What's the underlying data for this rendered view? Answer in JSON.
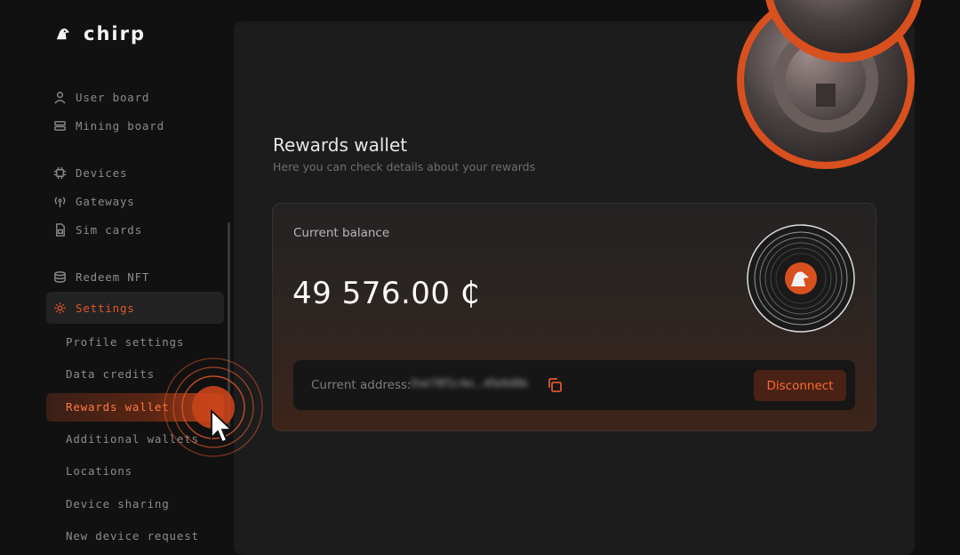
{
  "brand": {
    "name": "chirp",
    "logo_icon": "chirp-bird-icon"
  },
  "sidebar": {
    "items": [
      {
        "label": "User board",
        "icon": "user-icon"
      },
      {
        "label": "Mining board",
        "icon": "mining-icon"
      },
      {
        "label": "Devices",
        "icon": "chip-icon"
      },
      {
        "label": "Gateways",
        "icon": "antenna-icon"
      },
      {
        "label": "Sim cards",
        "icon": "sim-icon"
      },
      {
        "label": "Redeem NFT",
        "icon": "database-icon"
      },
      {
        "label": "Settings",
        "icon": "gear-icon",
        "active": true
      }
    ],
    "settings_sub": [
      "Profile settings",
      "Data credits",
      "Rewards wallet",
      "Additional wallets",
      "Locations",
      "Device sharing",
      "New device request"
    ],
    "active_sub": "Rewards wallet"
  },
  "page": {
    "title": "Rewards wallet",
    "subtitle": "Here you can check details about your rewards"
  },
  "balance_card": {
    "label": "Current balance",
    "amount": "49 576.00",
    "currency_symbol": "₵"
  },
  "address_bar": {
    "label": "Current address:",
    "value": "0xe78f1c4e...4fa9d8b",
    "copy_icon": "copy-icon",
    "disconnect_label": "Disconnect"
  },
  "colors": {
    "accent": "#e0572a",
    "background": "#111111",
    "panel": "#1c1c1c"
  }
}
